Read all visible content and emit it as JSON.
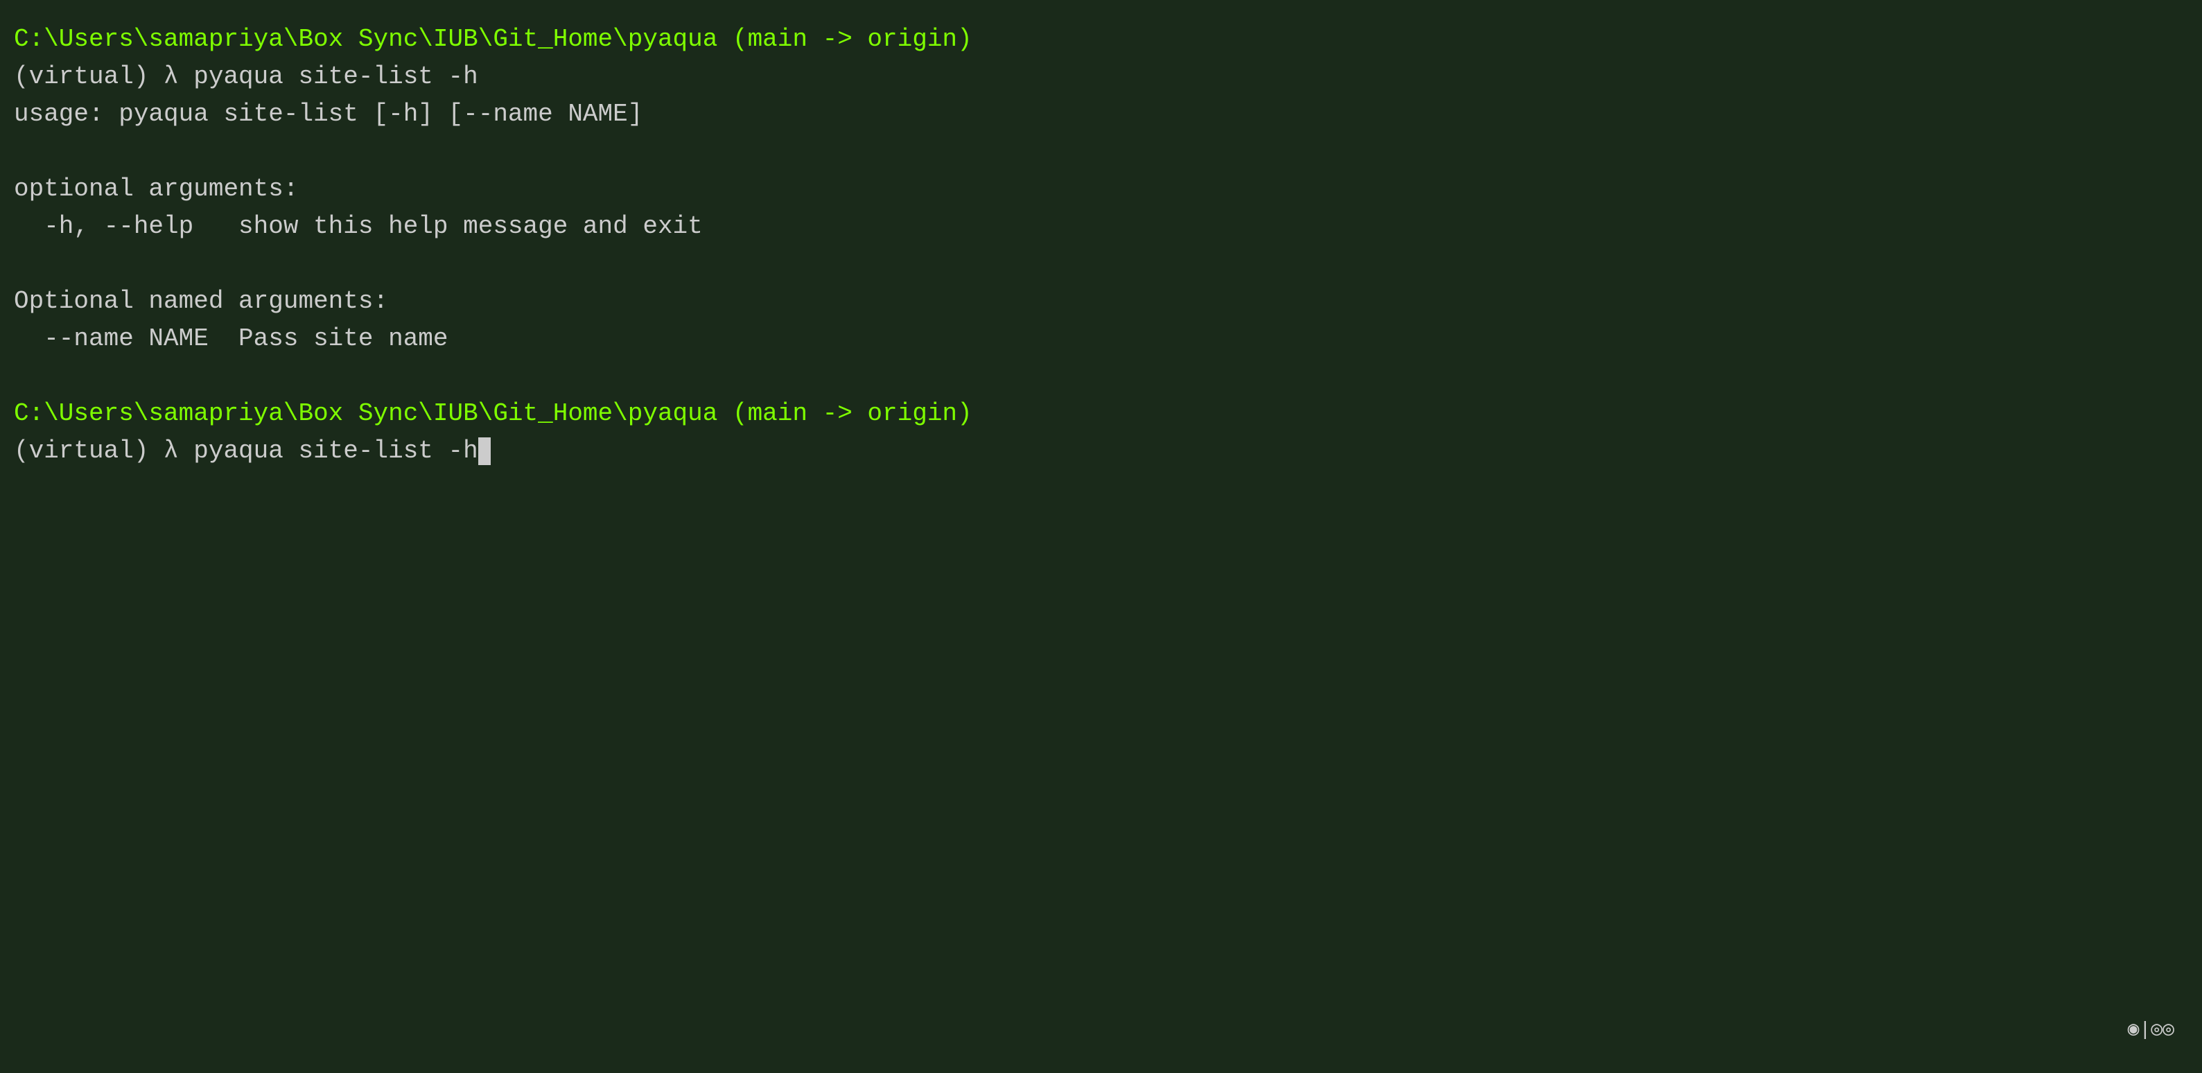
{
  "terminal": {
    "bg_color": "#1a2a1a",
    "lines": [
      {
        "type": "prompt-path",
        "text": "C:\\Users\\samapriya\\Box Sync\\IUB\\Git_Home\\pyaqua (main -> origin)"
      },
      {
        "type": "prompt-virtual",
        "text": "(virtual) λ pyaqua site-list -h"
      },
      {
        "type": "output",
        "text": "usage: pyaqua site-list [-h] [--name NAME]"
      },
      {
        "type": "empty"
      },
      {
        "type": "output",
        "text": "optional arguments:"
      },
      {
        "type": "output",
        "text": "  -h, --help   show this help message and exit"
      },
      {
        "type": "empty"
      },
      {
        "type": "output",
        "text": "Optional named arguments:"
      },
      {
        "type": "output",
        "text": "  --name NAME  Pass site name"
      },
      {
        "type": "empty"
      },
      {
        "type": "prompt-path",
        "text": "C:\\Users\\samapriya\\Box Sync\\IUB\\Git_Home\\pyaqua (main -> origin)"
      },
      {
        "type": "prompt-virtual-cursor",
        "text": "(virtual) λ pyaqua site-list -h"
      }
    ],
    "status_bar": "◉|◎◎"
  }
}
